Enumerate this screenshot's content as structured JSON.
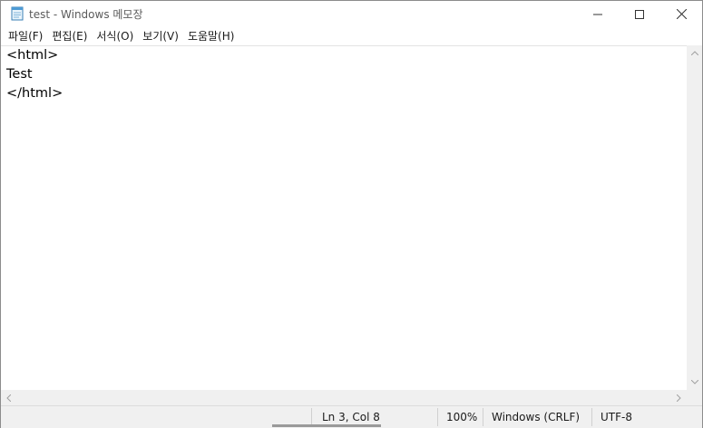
{
  "window": {
    "title": "test - Windows 메모장",
    "icon": "notepad-icon"
  },
  "window_controls": {
    "minimize_icon": "minimize-icon",
    "maximize_icon": "maximize-icon",
    "close_icon": "close-icon"
  },
  "menu": {
    "items": [
      {
        "label": "파일(F)"
      },
      {
        "label": "편집(E)"
      },
      {
        "label": "서식(O)"
      },
      {
        "label": "보기(V)"
      },
      {
        "label": "도움말(H)"
      }
    ]
  },
  "editor": {
    "lines": [
      "<html>",
      "Test",
      "</html>"
    ]
  },
  "statusbar": {
    "position": "Ln 3, Col 8",
    "zoom": "100%",
    "line_ending": "Windows (CRLF)",
    "encoding": "UTF-8"
  },
  "colors": {
    "background": "#ffffff",
    "chrome": "#f0f0f0",
    "text": "#000000"
  }
}
